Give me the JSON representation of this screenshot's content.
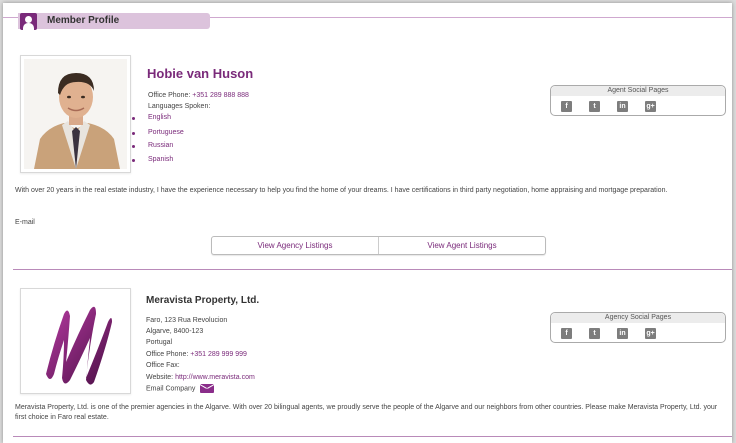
{
  "header": {
    "title": "Member Profile"
  },
  "agent": {
    "name": "Hobie van Huson",
    "office_phone_label": "Office Phone:",
    "office_phone": "+351 289 888 888",
    "languages_label": "Languages Spoken:",
    "languages": [
      "English",
      "Portuguese",
      "Russian",
      "Spanish"
    ],
    "social_title": "Agent Social Pages",
    "bio": "With over 20 years in the real estate industry, I have the experience necessary to help you find the home of your dreams. I have certifications in third party negotiation, home appraising and mortgage preparation.",
    "email_label": "E-mail"
  },
  "buttons": {
    "agency_listings": "View Agency Listings",
    "agent_listings": "View Agent Listings"
  },
  "company": {
    "name": "Meravista Property, Ltd.",
    "address_line1": "Faro, 123 Rua Revolucion",
    "address_line2": "Algarve, 8400-123",
    "country": "Portugal",
    "office_phone_label": "Office Phone:",
    "office_phone": "+351 289 999 999",
    "office_fax_label": "Office Fax:",
    "website_label": "Website:",
    "website": "http://www.meravista.com",
    "email_label": "Email Company",
    "social_title": "Agency Social Pages",
    "bio": "Meravista Property, Ltd. is one of the premier agencies in the Algarve. With over 20 bilingual agents, we proudly serve the people of the Algarve and our neighbors from other countries. Please make Meravista Property, Ltd. your first choice in Faro real estate."
  },
  "social_icons": [
    {
      "name": "facebook-icon",
      "glyph": "f"
    },
    {
      "name": "twitter-icon",
      "glyph": "t"
    },
    {
      "name": "linkedin-icon",
      "glyph": "in"
    },
    {
      "name": "google-plus-icon",
      "glyph": "g+"
    }
  ],
  "colors": {
    "accent": "#7a2a7a",
    "tab": "#dcc3dc",
    "divider": "#b98ab9"
  }
}
